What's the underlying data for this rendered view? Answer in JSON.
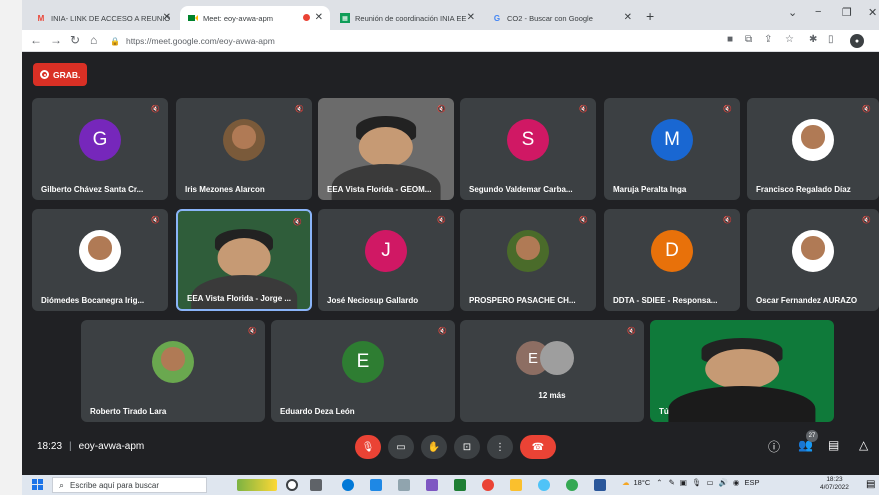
{
  "browser": {
    "tabs": [
      {
        "label": "INIA- LINK DE ACCESO A REUNIÓ",
        "icon": "gmail-icon",
        "active": false
      },
      {
        "label": "Meet: eoy-avwa-apm",
        "icon": "meet-icon",
        "active": true
      },
      {
        "label": "Reunión de coordinación INIA EE",
        "icon": "sheets-icon",
        "active": false
      },
      {
        "label": "CO2 - Buscar con Google",
        "icon": "google-icon",
        "active": false
      }
    ],
    "url": "https://meet.google.com/eoy-avwa-apm"
  },
  "meet": {
    "recording_label": "GRAB.",
    "participants": [
      {
        "name": "Gilberto Chávez Santa Cr...",
        "initial": "G",
        "color": "#7627bb",
        "photo": false
      },
      {
        "name": "Iris Mezones Alarcon",
        "initial": "",
        "color": "#7a5a3a",
        "photo": true
      },
      {
        "name": "EEA Vista Florida - GEOM...",
        "initial": "",
        "color": "#6b6b6b",
        "photo": true
      },
      {
        "name": "Segundo Valdemar Carba...",
        "initial": "S",
        "color": "#d01864",
        "photo": false
      },
      {
        "name": "Maruja Peralta Inga",
        "initial": "M",
        "color": "#1967d2",
        "photo": false
      },
      {
        "name": "Francisco Regalado Díaz",
        "initial": "",
        "color": "#ffffff",
        "photo": true
      },
      {
        "name": "Diómedes Bocanegra Irig...",
        "initial": "",
        "color": "#ffffff",
        "photo": true
      },
      {
        "name": "EEA Vista Florida - Jorge ...",
        "initial": "",
        "color": "#2f5d3a",
        "photo": true
      },
      {
        "name": "José Neciosup Gallardo",
        "initial": "J",
        "color": "#d01864",
        "photo": false
      },
      {
        "name": "PROSPERO PASACHE CH...",
        "initial": "",
        "color": "#4a6b2a",
        "photo": true
      },
      {
        "name": "DDTA - SDIEE - Responsa...",
        "initial": "D",
        "color": "#e8710a",
        "photo": false
      },
      {
        "name": "Oscar Fernandez AURAZO",
        "initial": "",
        "color": "#ffffff",
        "photo": true
      },
      {
        "name": "Roberto Tirado Lara",
        "initial": "",
        "color": "#6aa84f",
        "photo": true
      },
      {
        "name": "Eduardo Deza León",
        "initial": "E",
        "color": "#2e7d32",
        "photo": false
      },
      {
        "name": "12 más",
        "initial": "E",
        "color": "#8d6e63",
        "photo": false
      },
      {
        "name": "Tú",
        "initial": "",
        "color": "#0f7a3a",
        "photo": true
      }
    ],
    "time": "18:23",
    "meeting_code": "eoy-avwa-apm",
    "participant_count": "27"
  },
  "taskbar": {
    "search_placeholder": "Escribe aquí para buscar",
    "temperature": "18°C",
    "language": "ESP",
    "clock_time": "18:23",
    "clock_date": "4/07/2022"
  }
}
